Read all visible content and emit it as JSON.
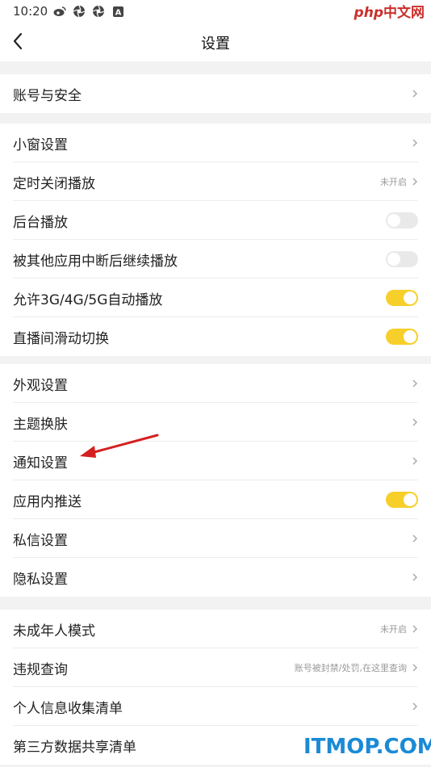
{
  "status_bar": {
    "time": "10:20",
    "icons": [
      "weibo-icon",
      "aperture-icon",
      "aperture-icon",
      "a-box-icon"
    ]
  },
  "watermark_top": {
    "php": "php",
    "cn": "中文网"
  },
  "nav": {
    "title": "设置"
  },
  "sections": [
    {
      "rows": [
        {
          "label": "账号与安全",
          "type": "link"
        }
      ]
    },
    {
      "rows": [
        {
          "label": "小窗设置",
          "type": "link"
        },
        {
          "label": "定时关闭播放",
          "type": "link",
          "value": "未开启"
        },
        {
          "label": "后台播放",
          "type": "toggle",
          "on": false
        },
        {
          "label": "被其他应用中断后继续播放",
          "type": "toggle",
          "on": false
        },
        {
          "label": "允许3G/4G/5G自动播放",
          "type": "toggle",
          "on": true
        },
        {
          "label": "直播间滑动切换",
          "type": "toggle",
          "on": true
        }
      ]
    },
    {
      "rows": [
        {
          "label": "外观设置",
          "type": "link"
        },
        {
          "label": "主题换肤",
          "type": "link"
        },
        {
          "label": "通知设置",
          "type": "link"
        },
        {
          "label": "应用内推送",
          "type": "toggle",
          "on": true
        },
        {
          "label": "私信设置",
          "type": "link"
        },
        {
          "label": "隐私设置",
          "type": "link"
        }
      ]
    },
    {
      "rows": [
        {
          "label": "未成年人模式",
          "type": "link",
          "value": "未开启"
        },
        {
          "label": "违规查询",
          "type": "link",
          "value": "账号被封禁/处罚,在这里查询"
        },
        {
          "label": "个人信息收集清单",
          "type": "link"
        },
        {
          "label": "第三方数据共享清单",
          "type": "link"
        }
      ]
    }
  ],
  "watermark_bottom": "ITMOP.COM",
  "colors": {
    "toggle_on": "#f7cf2a",
    "toggle_off": "#e9e9e9",
    "annotation_arrow": "#d42020"
  }
}
